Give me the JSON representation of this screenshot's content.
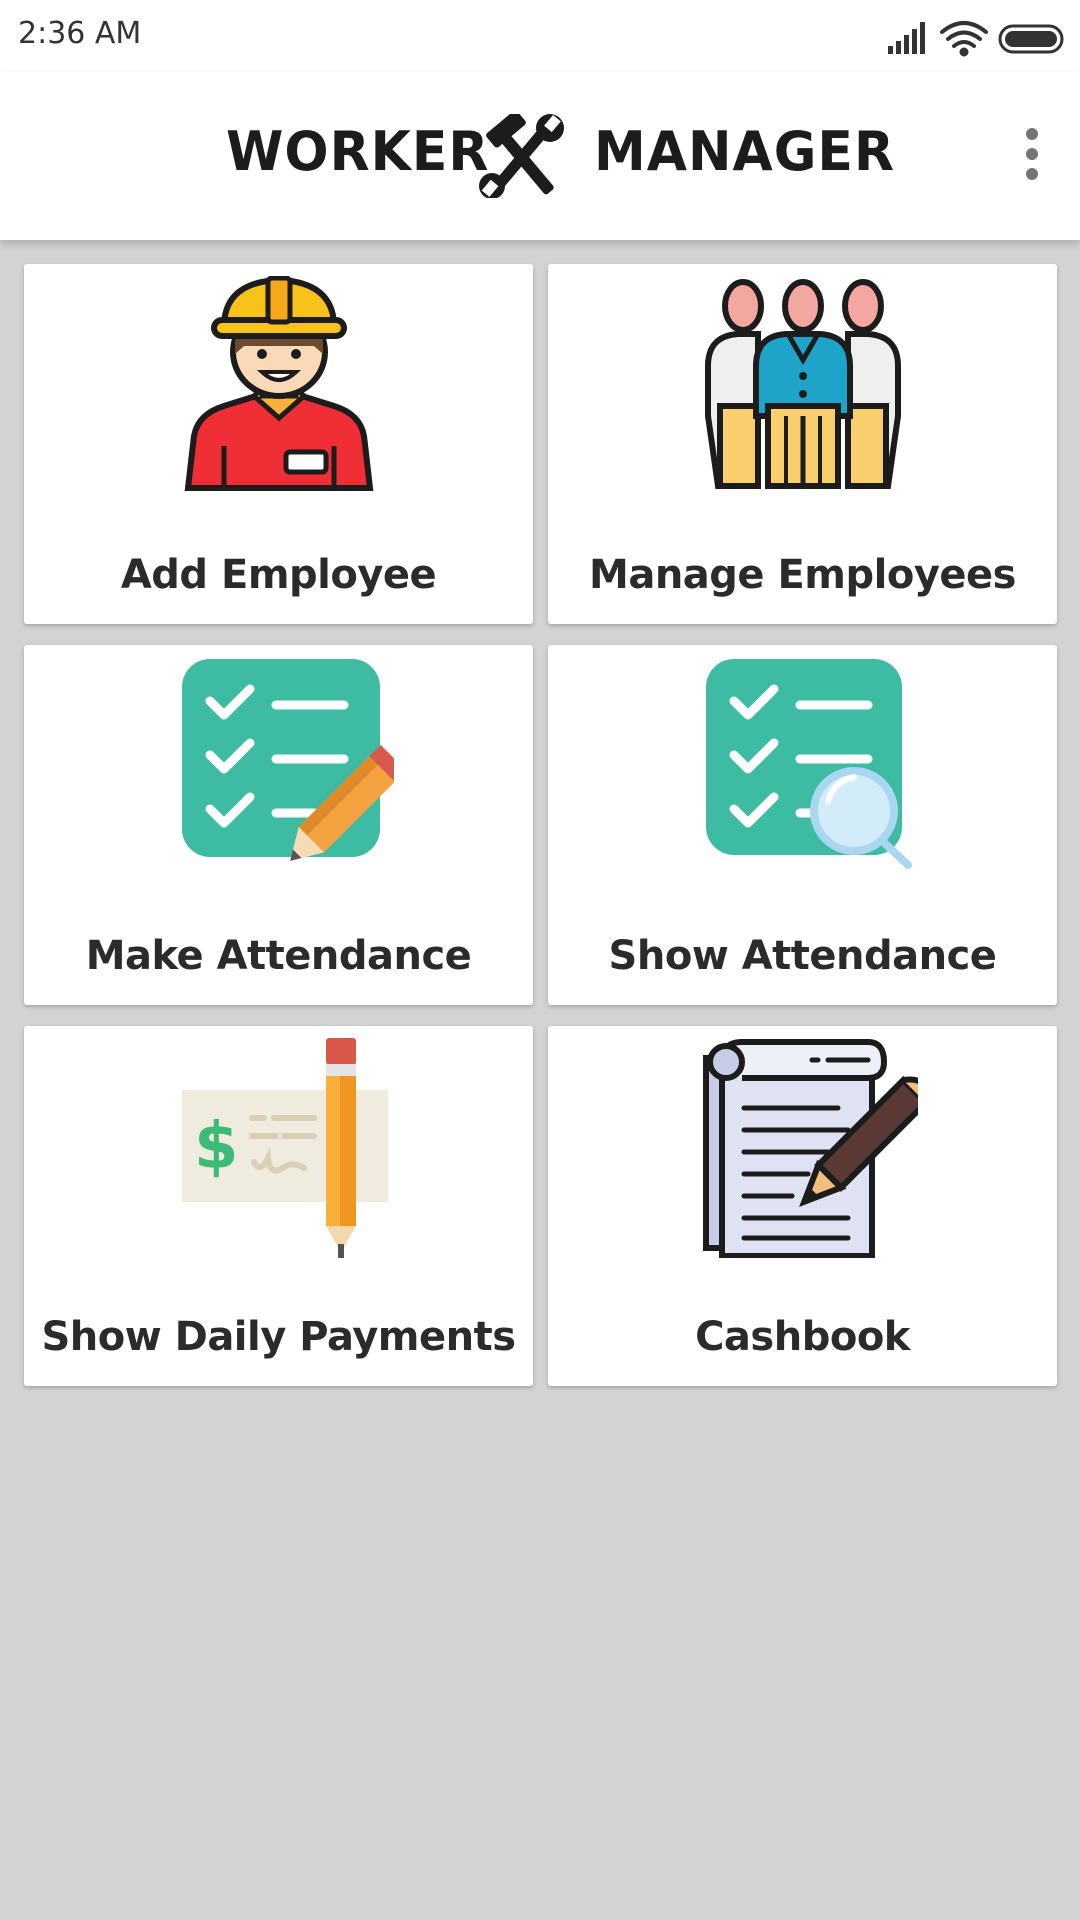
{
  "status_bar": {
    "time": "2:36 AM",
    "icons": [
      "signal-icon",
      "wifi-icon",
      "battery-icon"
    ]
  },
  "app_bar": {
    "title_left": "WORKER",
    "title_right": "MANAGER",
    "logo_icon": "hammer-wrench-icon",
    "menu_icon": "more-vert-icon"
  },
  "menu": [
    {
      "label": "Add Employee",
      "icon": "construction-worker-icon"
    },
    {
      "label": "Manage Employees",
      "icon": "employee-group-icon"
    },
    {
      "label": "Make Attendance",
      "icon": "checklist-pencil-icon"
    },
    {
      "label": "Show Attendance",
      "icon": "checklist-magnifier-icon"
    },
    {
      "label": "Show Daily Payments",
      "icon": "cheque-pencil-icon"
    },
    {
      "label": "Cashbook",
      "icon": "notebook-pen-icon"
    }
  ],
  "colors": {
    "background": "#d3d3d3",
    "card": "#ffffff",
    "text": "#2b2b2b",
    "checklist_teal": "#3dbba3",
    "helmet_yellow": "#f7c21a",
    "shirt_red": "#ef2e36"
  }
}
